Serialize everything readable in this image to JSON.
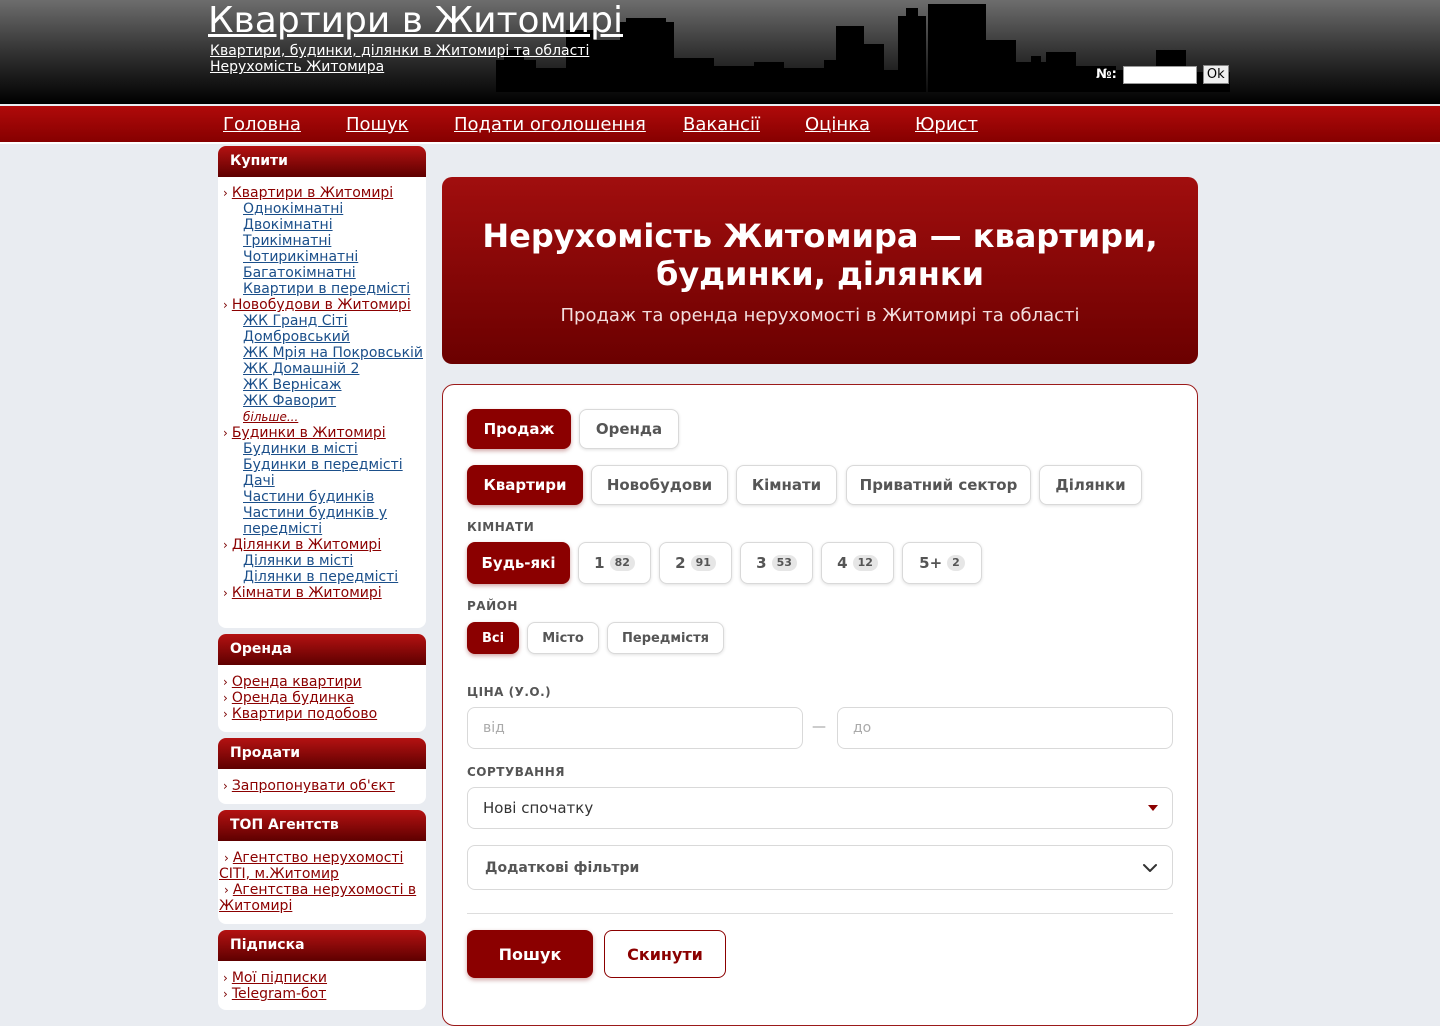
{
  "header": {
    "title": "Квартири в Житомирі",
    "subtitle1": "Квартири, будинки, ділянки в Житомирі та області",
    "subtitle2": "Нерухомість Житомира",
    "number_label": "№:",
    "number_value": "",
    "ok_label": "Ok"
  },
  "nav": {
    "items": [
      "Головна",
      "Пошук",
      "Подати оголошення",
      "Вакансії",
      "Оцінка",
      "Юрист"
    ]
  },
  "sidebar": {
    "buy": {
      "title": "Купити",
      "apartments": "Квартири в Житомирі",
      "apartment_subs": [
        "Однокімнатні",
        "Двокімнатні",
        "Трикімнатні",
        "Чотирикімнатні",
        "Багатокімнатні",
        "Квартири в передмісті"
      ],
      "newbuilds": "Новобудови в Житомирі",
      "newbuild_subs": [
        "ЖК Гранд Сіті",
        "Домбровський",
        "ЖК Мрія на Покровській",
        "ЖК Домашній 2",
        "ЖК Вернісаж",
        "ЖК Фаворит"
      ],
      "more": "більше...",
      "houses": "Будинки в Житомирі",
      "house_subs": [
        "Будинки в місті",
        "Будинки в передмісті",
        "Дачі",
        "Частини будинків",
        "Частини будинків у передмісті"
      ],
      "plots": "Ділянки в Житомирі",
      "plot_subs": [
        "Ділянки в місті",
        "Ділянки в передмісті"
      ],
      "rooms": "Кімнати в Житомирі"
    },
    "rent": {
      "title": "Оренда",
      "items": [
        "Оренда квартири",
        "Оренда будинка",
        "Квартири подобово"
      ]
    },
    "sell": {
      "title": "Продати",
      "items": [
        "Запропонувати об'єкт"
      ]
    },
    "agencies": {
      "title": "ТОП Агентств",
      "items": [
        "Агентство нерухомості СІТІ, м.Житомир",
        "Агентства нерухомості в Житомирі"
      ]
    },
    "subscription": {
      "title": "Підписка",
      "items": [
        "Мої підписки",
        "Telegram-бот"
      ]
    }
  },
  "hero": {
    "title": "Нерухомість Житомира — квартири, будинки, ділянки",
    "subtitle": "Продаж та оренда нерухомості в Житомирі та області"
  },
  "filters": {
    "deal": [
      "Продаж",
      "Оренда"
    ],
    "deal_active": "Продаж",
    "types": [
      "Квартири",
      "Новобудови",
      "Кімнати",
      "Приватний сектор",
      "Ділянки"
    ],
    "type_active": "Квартири",
    "rooms_label": "КІМНАТИ",
    "rooms": [
      {
        "label": "Будь-які",
        "count": ""
      },
      {
        "label": "1",
        "count": "82"
      },
      {
        "label": "2",
        "count": "91"
      },
      {
        "label": "3",
        "count": "53"
      },
      {
        "label": "4",
        "count": "12"
      },
      {
        "label": "5+",
        "count": "2"
      }
    ],
    "district_label": "РАЙОН",
    "districts": [
      "Всі",
      "Місто",
      "Передмістя"
    ],
    "price_label": "ЦІНА (У.О.)",
    "price_from_placeholder": "від",
    "price_dash": "—",
    "price_to_placeholder": "до",
    "sort_label": "СОРТУВАННЯ",
    "sort_value": "Нові спочатку",
    "extra_label": "Додаткові фільтри",
    "search_label": "Пошук",
    "reset_label": "Скинути"
  },
  "colors": {
    "accent": "#8b0000",
    "link": "#1b4f8a",
    "background": "#e9ecf1"
  }
}
